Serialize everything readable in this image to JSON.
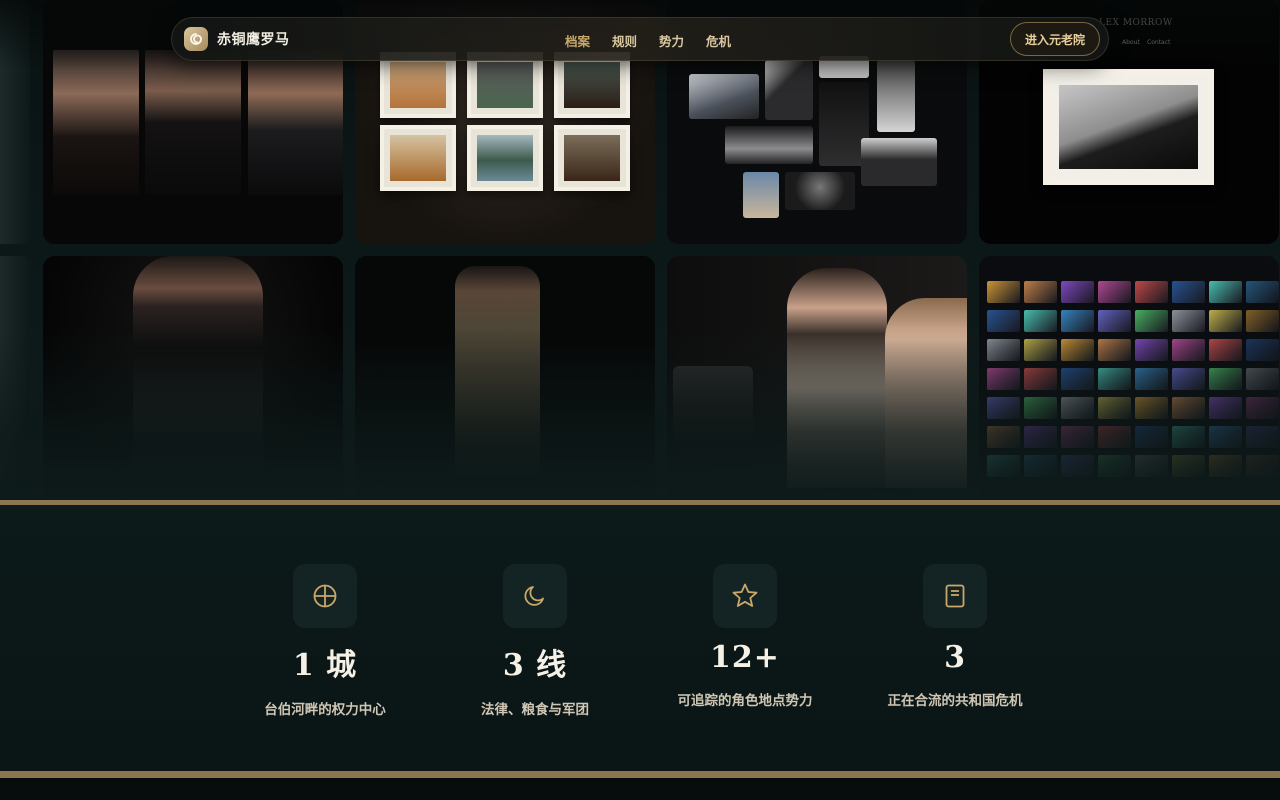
{
  "brand": {
    "name": "赤铜鹰罗马",
    "logo_icon": "spiral-logo-icon"
  },
  "nav": {
    "links": [
      {
        "label": "档案",
        "active": true
      },
      {
        "label": "规则",
        "active": false
      },
      {
        "label": "势力",
        "active": false
      },
      {
        "label": "危机",
        "active": false
      }
    ],
    "cta_label": "进入元老院"
  },
  "gallery": {
    "tiles": [
      {
        "name": "fashion-portraits-trio"
      },
      {
        "name": "framed-art-wall"
      },
      {
        "name": "product-moodboard"
      },
      {
        "name": "photographer-portfolio",
        "overlay_text": [
          "LEX MORROW",
          "About",
          "Contact"
        ]
      },
      {
        "name": "leather-fashion-portrait"
      },
      {
        "name": "trench-coat-fashion"
      },
      {
        "name": "makeup-artist-scene"
      },
      {
        "name": "colorful-illustration-grid"
      }
    ]
  },
  "stats": [
    {
      "icon": "compass-icon",
      "value": "1 城",
      "label": "台伯河畔的权力中心"
    },
    {
      "icon": "moon-icon",
      "value": "3 线",
      "label": "法律、粮食与军团"
    },
    {
      "icon": "star-icon",
      "value": "12+",
      "label": "可追踪的角色地点势力"
    },
    {
      "icon": "book-icon",
      "value": "3",
      "label": "正在合流的共和国危机"
    }
  ],
  "colors": {
    "accent": "#c9a86a",
    "background": "#0b1414",
    "divider": "#8b7650"
  }
}
